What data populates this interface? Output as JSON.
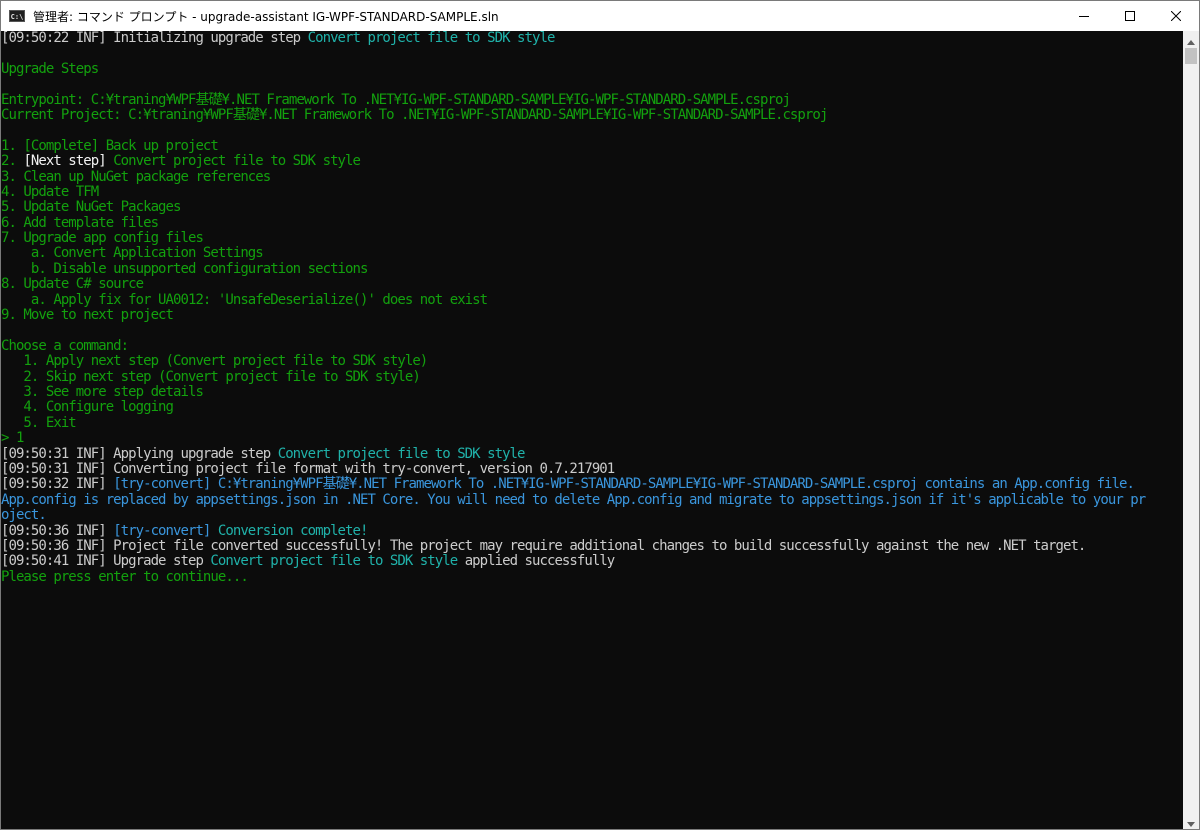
{
  "window": {
    "title": "管理者: コマンド プロンプト - upgrade-assistant  IG-WPF-STANDARD-SAMPLE.sln",
    "icon": "command-prompt-icon",
    "buttons": [
      "minimize-icon",
      "maximize-icon",
      "close-icon"
    ]
  },
  "colors": {
    "background": "#0c0c0c",
    "default_text": "#cccccc",
    "cyan": "#3a96dd",
    "teal": "#20b2aa",
    "green": "#13a10e",
    "white": "#f2f2f2"
  },
  "terminal": {
    "lines": [
      {
        "segments": [
          {
            "text": "[09:50:22 INF] Initializing upgrade step ",
            "color": "gray"
          },
          {
            "text": "Convert project file to SDK style",
            "color": "teal"
          }
        ]
      },
      {
        "segments": [
          {
            "text": "",
            "color": "gray"
          }
        ]
      },
      {
        "segments": [
          {
            "text": "Upgrade Steps",
            "color": "green"
          }
        ]
      },
      {
        "segments": [
          {
            "text": "",
            "color": "gray"
          }
        ]
      },
      {
        "segments": [
          {
            "text": "Entrypoint: C:¥traning¥WPF基礎¥.NET Framework To .NET¥IG-WPF-STANDARD-SAMPLE¥IG-WPF-STANDARD-SAMPLE.csproj",
            "color": "green"
          }
        ]
      },
      {
        "segments": [
          {
            "text": "Current Project: C:¥traning¥WPF基礎¥.NET Framework To .NET¥IG-WPF-STANDARD-SAMPLE¥IG-WPF-STANDARD-SAMPLE.csproj",
            "color": "green"
          }
        ]
      },
      {
        "segments": [
          {
            "text": "",
            "color": "gray"
          }
        ]
      },
      {
        "segments": [
          {
            "text": "1. [Complete] Back up project",
            "color": "green"
          }
        ]
      },
      {
        "segments": [
          {
            "text": "2. ",
            "color": "green"
          },
          {
            "text": "[Next step]",
            "color": "white"
          },
          {
            "text": " Convert project file to SDK style",
            "color": "green"
          }
        ]
      },
      {
        "segments": [
          {
            "text": "3. Clean up NuGet package references",
            "color": "green"
          }
        ]
      },
      {
        "segments": [
          {
            "text": "4. Update TFM",
            "color": "green"
          }
        ]
      },
      {
        "segments": [
          {
            "text": "5. Update NuGet Packages",
            "color": "green"
          }
        ]
      },
      {
        "segments": [
          {
            "text": "6. Add template files",
            "color": "green"
          }
        ]
      },
      {
        "segments": [
          {
            "text": "7. Upgrade app config files",
            "color": "green"
          }
        ]
      },
      {
        "segments": [
          {
            "text": "    a. Convert Application Settings",
            "color": "green"
          }
        ]
      },
      {
        "segments": [
          {
            "text": "    b. Disable unsupported configuration sections",
            "color": "green"
          }
        ]
      },
      {
        "segments": [
          {
            "text": "8. Update C# source",
            "color": "green"
          }
        ]
      },
      {
        "segments": [
          {
            "text": "    a. Apply fix for UA0012: 'UnsafeDeserialize()' does not exist",
            "color": "green"
          }
        ]
      },
      {
        "segments": [
          {
            "text": "9. Move to next project",
            "color": "green"
          }
        ]
      },
      {
        "segments": [
          {
            "text": "",
            "color": "gray"
          }
        ]
      },
      {
        "segments": [
          {
            "text": "Choose a command:",
            "color": "green"
          }
        ]
      },
      {
        "segments": [
          {
            "text": "   1. Apply next step (Convert project file to SDK style)",
            "color": "green"
          }
        ]
      },
      {
        "segments": [
          {
            "text": "   2. Skip next step (Convert project file to SDK style)",
            "color": "green"
          }
        ]
      },
      {
        "segments": [
          {
            "text": "   3. See more step details",
            "color": "green"
          }
        ]
      },
      {
        "segments": [
          {
            "text": "   4. Configure logging",
            "color": "green"
          }
        ]
      },
      {
        "segments": [
          {
            "text": "   5. Exit",
            "color": "green"
          }
        ]
      },
      {
        "segments": [
          {
            "text": "> 1",
            "color": "green"
          }
        ]
      },
      {
        "segments": [
          {
            "text": "[09:50:31 INF] Applying upgrade step ",
            "color": "gray"
          },
          {
            "text": "Convert project file to SDK style",
            "color": "teal"
          }
        ]
      },
      {
        "segments": [
          {
            "text": "[09:50:31 INF] Converting project file format with try-convert, version 0.7.217901",
            "color": "gray"
          }
        ]
      },
      {
        "segments": [
          {
            "text": "[09:50:32 INF] ",
            "color": "gray"
          },
          {
            "text": "[try-convert] C:¥traning¥WPF基礎¥.NET Framework To .NET¥IG-WPF-STANDARD-SAMPLE¥IG-WPF-STANDARD-SAMPLE.csproj contains an App.config file.",
            "color": "cyan"
          }
        ]
      },
      {
        "segments": [
          {
            "text": "App.config is replaced by appsettings.json in .NET Core. You will need to delete App.config and migrate to appsettings.json if it's applicable to your pr",
            "color": "cyan"
          }
        ]
      },
      {
        "segments": [
          {
            "text": "oject.",
            "color": "cyan"
          }
        ]
      },
      {
        "segments": [
          {
            "text": "[09:50:36 INF] ",
            "color": "gray"
          },
          {
            "text": "[try-convert] ",
            "color": "cyan"
          },
          {
            "text": "Conversion complete!",
            "color": "teal"
          }
        ]
      },
      {
        "segments": [
          {
            "text": "[09:50:36 INF] Project file converted successfully! The project may require additional changes to build successfully against the new .NET target.",
            "color": "gray"
          }
        ]
      },
      {
        "segments": [
          {
            "text": "[09:50:41 INF] Upgrade step ",
            "color": "gray"
          },
          {
            "text": "Convert project file to SDK style",
            "color": "teal"
          },
          {
            "text": " applied successfully",
            "color": "gray"
          }
        ]
      },
      {
        "segments": [
          {
            "text": "Please press enter to continue...",
            "color": "green"
          }
        ]
      }
    ]
  },
  "scrollbar": {
    "position": 0
  }
}
